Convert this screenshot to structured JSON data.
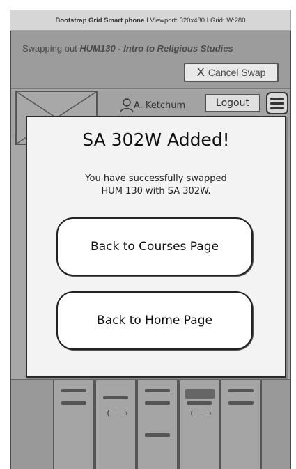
{
  "device_header": {
    "title": "Bootstrap Grid Smart phone",
    "meta": "I  Viewport: 320x480  I  Grid: W:280"
  },
  "swap_banner": {
    "prefix": "Swapping out ",
    "course": "HUM130 - Intro to Religious Studies",
    "cancel_label": "Cancel Swap",
    "cancel_icon": "X"
  },
  "nav": {
    "user_name": "A. Ketchum",
    "logout_label": "Logout"
  },
  "modal": {
    "title": "SA 302W Added!",
    "message_line1": "You have successfully swapped",
    "message_line2": "HUM 130 with SA 302W.",
    "courses_button": "Back to Courses Page",
    "home_button": "Back to Home Page"
  },
  "colors": {
    "frame_gray": "#a8a8a8",
    "modal_bg": "#f3f3f3",
    "button_bg": "#ffffff"
  }
}
